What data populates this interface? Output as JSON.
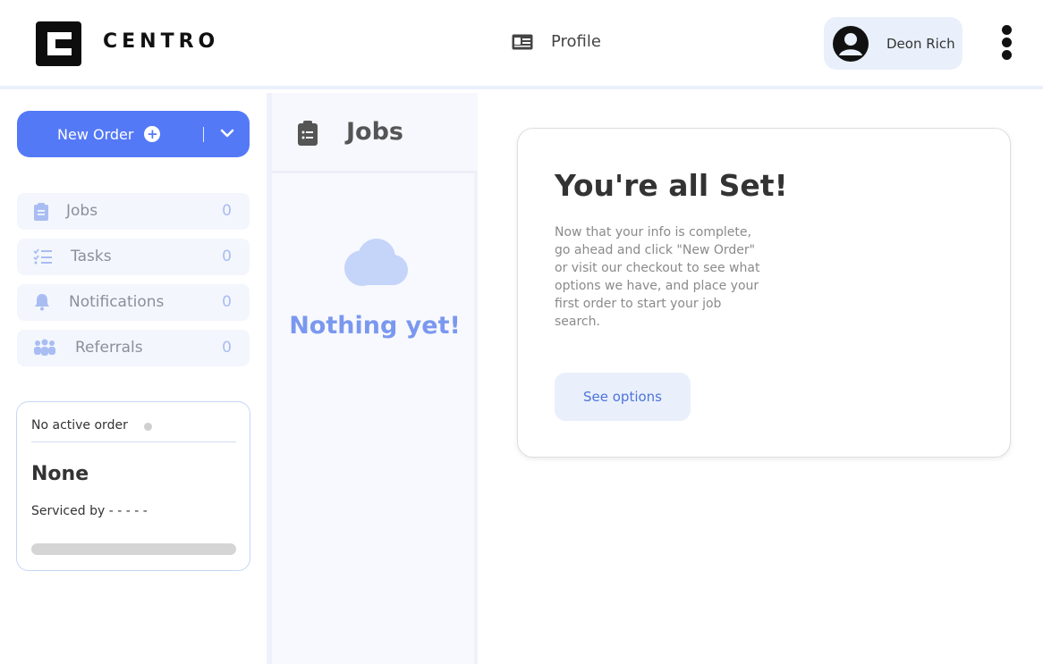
{
  "header": {
    "brand": "CENTRO",
    "profile_label": "Profile",
    "user_name": "Deon Rich"
  },
  "sidebar": {
    "new_order_label": "New Order",
    "items": [
      {
        "label": "Jobs",
        "count": "0",
        "icon": "clipboard-icon"
      },
      {
        "label": "Tasks",
        "count": "0",
        "icon": "task-list-icon"
      },
      {
        "label": "Notifications",
        "count": "0",
        "icon": "bell-icon"
      },
      {
        "label": "Referrals",
        "count": "0",
        "icon": "people-icon"
      }
    ],
    "order_card": {
      "status": "No active order",
      "name": "None",
      "serviced_by": "Serviced by - - - - -"
    }
  },
  "jobs_panel": {
    "title": "Jobs",
    "empty_text": "Nothing yet!"
  },
  "main": {
    "title": "You're all Set!",
    "description": "Now that your info is complete, go ahead and click \"New Order\" or visit our checkout to see what options we have, and place your first order to start your job search.",
    "button_label": "See options"
  },
  "colors": {
    "accent": "#5479f7",
    "soft_accent": "#e9f0fb",
    "muted_count": "#a9bdf2",
    "cloud": "#c5d4f9"
  }
}
